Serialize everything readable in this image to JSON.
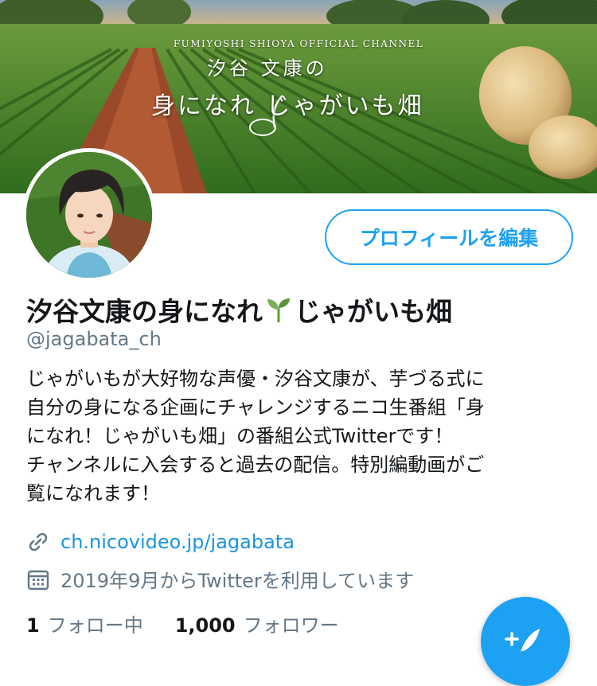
{
  "banner": {
    "channel_label": "FUMIYOSHI SHIOYA OFFICIAL CHANNEL",
    "title_line1": "汐谷 文康の",
    "title_line2": "身になれ じゃがいも畑"
  },
  "profile": {
    "edit_button_label": "プロフィールを編集",
    "display_name_part1": "汐谷文康の身になれ",
    "display_name_part2": "じゃがいも畑",
    "handle": "@jagabata_ch",
    "bio_lines": [
      "じゃがいもが大好物な声優・汐谷文康が、芋づる式に",
      "自分の身になる企画にチャレンジするニコ生番組「身",
      "になれ！じゃがいも畑」の番組公式Twitterです！",
      "チャンネルに入会すると過去の配信。特別編動画がご",
      "覧になれます！"
    ],
    "link": "ch.nicovideo.jp/jagabata",
    "joined": "2019年9月からTwitterを利用しています",
    "following_count": "1",
    "following_label": "フォロー中",
    "followers_count": "1,000",
    "followers_label": "フォロワー"
  },
  "icons": {
    "link": "link-icon",
    "calendar": "calendar-icon",
    "seedling": "seedling-icon",
    "compose": "compose-tweet-icon"
  },
  "colors": {
    "accent": "#1da1f2",
    "link": "#1b95e0",
    "secondary_text": "#657786",
    "primary_text": "#14171a"
  }
}
